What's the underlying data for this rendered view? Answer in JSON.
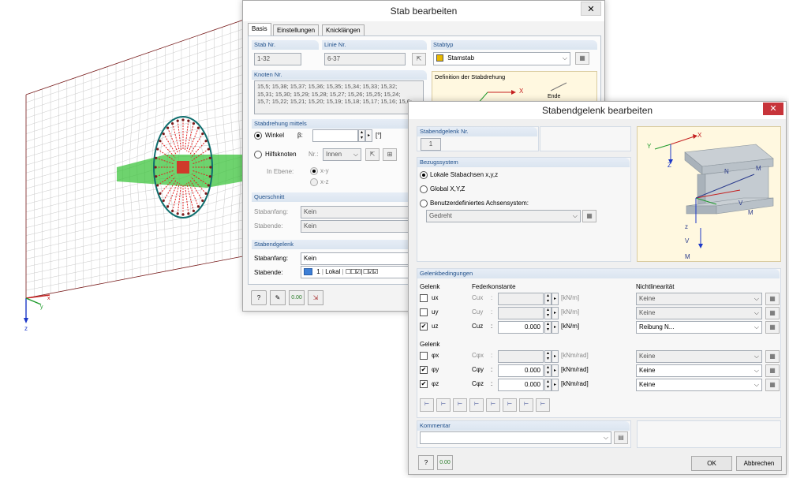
{
  "model": {
    "axis_labels": {
      "x": "x",
      "y": "y",
      "z": "z"
    }
  },
  "stab": {
    "title": "Stab bearbeiten",
    "tabs": [
      "Basis",
      "Einstellungen",
      "Knicklängen"
    ],
    "stab_nr_label": "Stab Nr.",
    "stab_nr": "1-32",
    "linie_nr_label": "Linie Nr.",
    "linie_nr": "6-37",
    "stabtyp_label": "Stabtyp",
    "stabtyp_value": "Stamstab",
    "stabtyp_color": "#e8b800",
    "definition_label": "Definition der Stabdrehung",
    "def_x": "X",
    "def_ende": "Ende",
    "knoten_label": "Knoten Nr.",
    "knoten_lines": [
      "15,5; 15,38; 15,37; 15,36; 15,35; 15,34; 15,33; 15,32;",
      "15,31; 15,30; 15,29; 15,28; 15,27; 15,26; 15,25; 15,24;",
      "15,7; 15,22; 15,21; 15,20; 15,19; 15,18; 15,17; 15,16; 15,6;"
    ],
    "stabdrehung_label": "Stabdrehung mittels",
    "winkel_label": "Winkel",
    "beta_label": "β:",
    "beta_unit": "[°]",
    "hilfsknoten_label": "Hilfsknoten",
    "nr_label": "Nr.:",
    "innen_value": "Innen",
    "in_ebene_label": "In Ebene:",
    "xy_label": "x-y",
    "xz_label": "x-z",
    "querschnitt_label": "Querschnitt",
    "stabanfang_label": "Stabanfang:",
    "stabanfang_value": "Kein",
    "stabende_label": "Stabende:",
    "stabende_value": "Kein",
    "gelenk_label": "Stabendgelenk",
    "gelenk_anfang_label": "Stabanfang:",
    "gelenk_anfang_value": "Kein",
    "gelenk_ende_label": "Stabende:",
    "gelenk_ende_nr": "1",
    "gelenk_ende_sys": "Lokal",
    "gelenk_ende_color": "#3d7fd6"
  },
  "gelenk": {
    "title": "Stabendgelenk bearbeiten",
    "nr_label": "Stabendgelenk Nr.",
    "nr_value": "1",
    "bezug_label": "Bezugssystem",
    "opt_lokal": "Lokale Stabachsen x,y,z",
    "opt_global": "Global X,Y,Z",
    "opt_benutzer": "Benutzerdefiniertes Achsensystem:",
    "gedreht_value": "Gedreht",
    "preview": {
      "Y": "Y",
      "X": "X",
      "Z": "Z",
      "N": "N",
      "MT": "M",
      "z": "z",
      "Vy": "V",
      "My": "M",
      "Vz": "V",
      "Mz": "M"
    },
    "bedingungen_label": "Gelenkbedingungen",
    "col_gelenk": "Gelenk",
    "col_feder": "Federkonstante",
    "col_nichtlin": "Nichtlinearität",
    "rows_u": [
      {
        "name": "ux",
        "sym": "Cux",
        "checked": false,
        "value": "",
        "unit": "[kN/m]",
        "nl": "Keine",
        "enabled": false
      },
      {
        "name": "uy",
        "sym": "Cuy",
        "checked": false,
        "value": "",
        "unit": "[kN/m]",
        "nl": "Keine",
        "enabled": false
      },
      {
        "name": "uz",
        "sym": "Cuz",
        "checked": true,
        "value": "0.000",
        "unit": "[kN/m]",
        "nl": "Reibung N...",
        "enabled": true
      }
    ],
    "rows_phi": [
      {
        "name": "φx",
        "sym": "Cφx",
        "checked": false,
        "value": "",
        "unit": "[kNm/rad]",
        "nl": "Keine",
        "enabled": false
      },
      {
        "name": "φy",
        "sym": "Cφy",
        "checked": true,
        "value": "0.000",
        "unit": "[kNm/rad]",
        "nl": "Keine",
        "enabled": true
      },
      {
        "name": "φz",
        "sym": "Cφz",
        "checked": true,
        "value": "0.000",
        "unit": "[kNm/rad]",
        "nl": "Keine",
        "enabled": true
      }
    ],
    "kommentar_label": "Kommentar",
    "ok_label": "OK",
    "cancel_label": "Abbrechen"
  }
}
